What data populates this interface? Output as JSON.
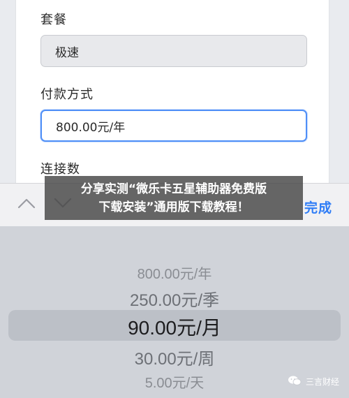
{
  "form": {
    "package_label": "套餐",
    "package_value": "极速",
    "payment_label": "付款方式",
    "payment_value": "800.00元/年",
    "connections_label": "连接数"
  },
  "toolbar": {
    "up_icon": "chevron-up-icon",
    "down_icon": "chevron-down-icon",
    "done_label": "完成"
  },
  "banner": {
    "line1": "分享实测“微乐卡五星辅助器免费版",
    "line2": "下载安装”通用版下载教程！"
  },
  "picker": {
    "options": [
      "800.00元/年",
      "250.00元/季",
      "90.00元/月",
      "30.00元/周",
      "5.00元/天"
    ],
    "selected_index": 2
  },
  "watermark": {
    "icon": "wechat-icon",
    "text": "三言财经"
  },
  "colors": {
    "accent": "#2f7df6",
    "picker_bg": "#d0d3d9",
    "selected_band": "#bcc0c7"
  }
}
